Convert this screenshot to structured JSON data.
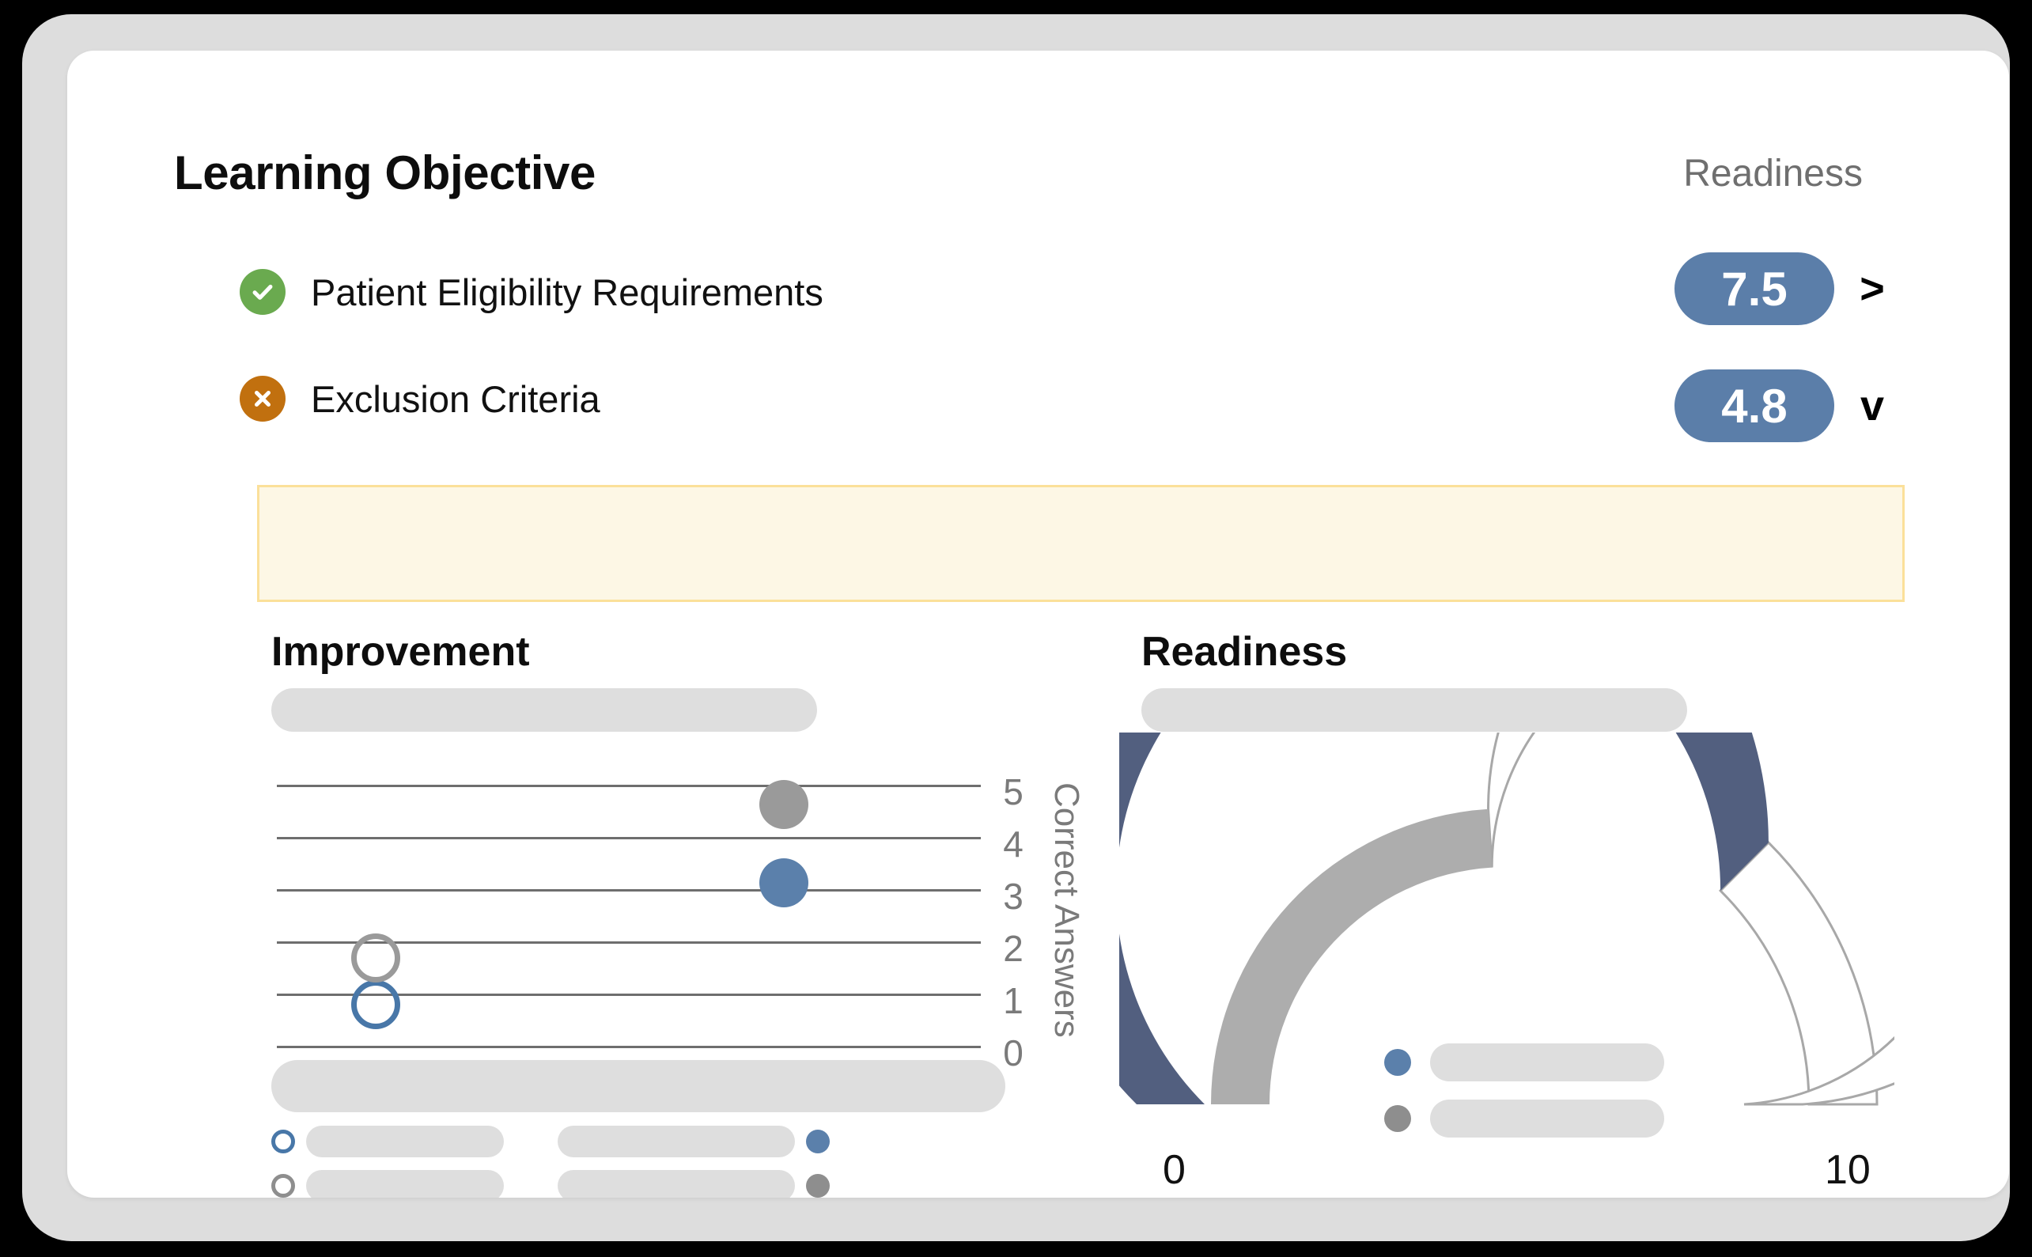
{
  "header": {
    "title": "Learning Objective",
    "readiness_label": "Readiness"
  },
  "objectives": [
    {
      "label": "Patient Eligibility Requirements",
      "status": "pass",
      "status_icon": "check-circle-icon",
      "score": "7.5",
      "chevron": ">",
      "chevron_icon": "chevron-right-icon"
    },
    {
      "label": "Exclusion Criteria",
      "status": "fail",
      "status_icon": "x-circle-icon",
      "score": "4.8",
      "chevron": "v",
      "chevron_icon": "chevron-down-icon"
    }
  ],
  "notice_banner": {
    "text": "",
    "background": "#fdf7e5",
    "border": "#fbe09a"
  },
  "panels": {
    "improvement": {
      "heading": "Improvement"
    },
    "readiness": {
      "heading": "Readiness"
    }
  },
  "colors": {
    "badge_blue": "#5b7ea9",
    "series_blue": "#5b80ab",
    "series_gray": "#9a9a9a",
    "gauge_outer_navy": "#525f7f",
    "gauge_inner_gray": "#adadad",
    "pass_green": "#6aaa4f",
    "fail_orange": "#c1700f",
    "placeholder_gray": "#dedede"
  },
  "chart_data": [
    {
      "type": "scatter",
      "title": "Improvement",
      "xlabel": "",
      "ylabel": "Correct Answers",
      "ylim": [
        0,
        5
      ],
      "ytick_labels": [
        "5",
        "4",
        "3",
        "2",
        "1",
        "0"
      ],
      "yticks": [
        5,
        4,
        3,
        2,
        1,
        0
      ],
      "grid": true,
      "x": [
        1,
        2
      ],
      "series": [
        {
          "name": "blue",
          "color": "#5b80ab",
          "points": [
            {
              "x": 1,
              "y": 1.0,
              "style": "hollow"
            },
            {
              "x": 2,
              "y": 3.0,
              "style": "filled"
            }
          ]
        },
        {
          "name": "gray",
          "color": "#9a9a9a",
          "points": [
            {
              "x": 1,
              "y": 1.9,
              "style": "hollow"
            },
            {
              "x": 2,
              "y": 4.5,
              "style": "filled"
            }
          ]
        }
      ],
      "legend_position": "bottom"
    },
    {
      "type": "gauge",
      "title": "Readiness",
      "min": 0,
      "max": 10,
      "min_label": "0",
      "max_label": "10",
      "arcs": [
        {
          "name": "outer",
          "value": 7.5,
          "color": "#525f7f",
          "track_color": "#ffffff"
        },
        {
          "name": "inner",
          "value": 4.8,
          "color": "#adadad",
          "track_color": "#ffffff"
        }
      ],
      "legend_position": "center"
    }
  ],
  "improvement_legend": {
    "rows": [
      {
        "marker": "hollow-blue",
        "end_marker": "solid-blue"
      },
      {
        "marker": "hollow-gray",
        "end_marker": "solid-gray"
      }
    ]
  }
}
